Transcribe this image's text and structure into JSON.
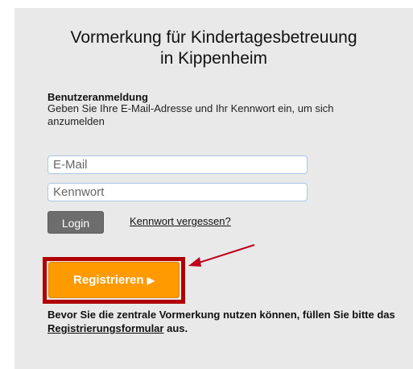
{
  "header": {
    "title_line1": "Vormerkung für Kindertagesbetreuung",
    "title_line2": "in Kippenheim"
  },
  "login": {
    "heading": "Benutzeranmeldung",
    "description": "Geben Sie Ihre E-Mail-Adresse und Ihr Kennwort ein, um sich anzumelden",
    "email_placeholder": "E-Mail",
    "password_placeholder": "Kennwort",
    "login_label": "Login",
    "forgot_label": "Kennwort vergessen?"
  },
  "register": {
    "button_label": "Registrieren",
    "button_icon": "play-arrow-icon",
    "note_before": "Bevor Sie die zentrale Vormerkung nutzen können, füllen Sie bitte das ",
    "note_link": "Registrierungsformular",
    "note_after": " aus."
  },
  "colors": {
    "panel_bg": "#e9e9e9",
    "login_button": "#6d6d6d",
    "register_button": "#ff9a00",
    "highlight": "#b00000",
    "annotation_arrow": "#c0001a"
  }
}
